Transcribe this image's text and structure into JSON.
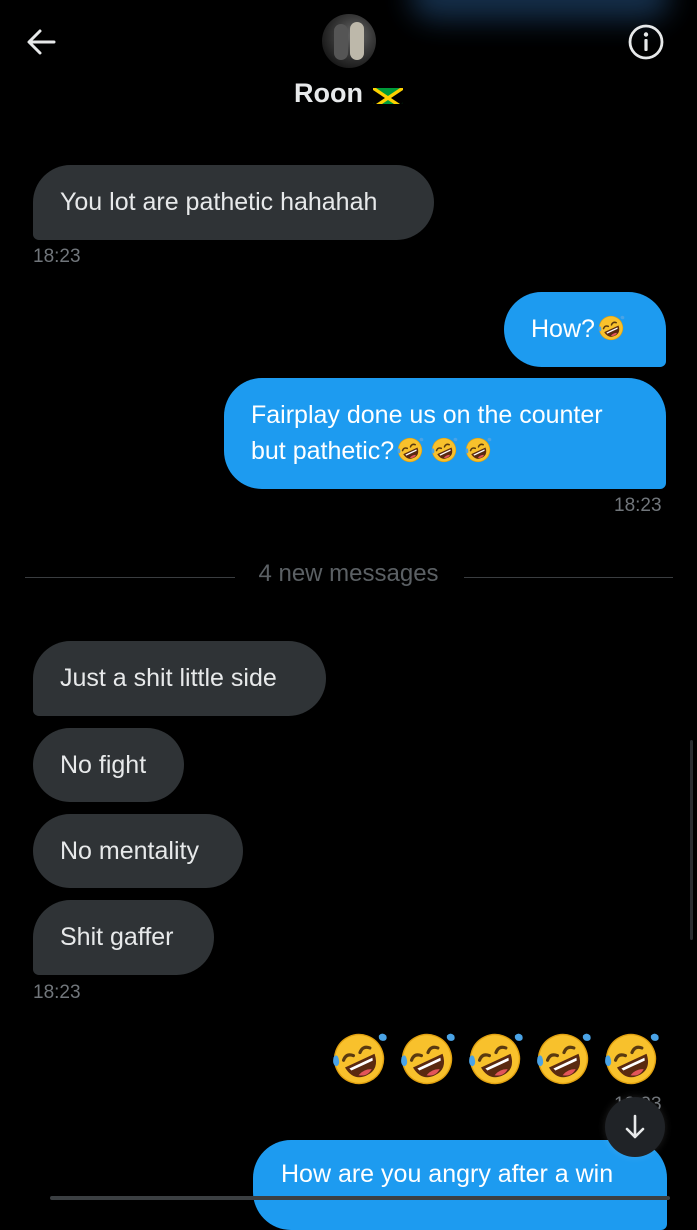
{
  "header": {
    "contact_name": "Roon",
    "back_icon": "arrow-left-icon",
    "info_icon": "info-circle-icon",
    "flag": "jamaica-flag"
  },
  "messages": [
    {
      "direction": "in",
      "text": "You lot are pathetic hahahah"
    },
    {
      "direction": "out",
      "text": "How?",
      "emoji": [
        "rofl"
      ]
    },
    {
      "direction": "out",
      "line1": "Fairplay done us on the counter",
      "line2": "but pathetic?",
      "emoji": [
        "rofl",
        "rofl",
        "rofl"
      ]
    },
    {
      "direction": "in",
      "text": "Just a shit little side"
    },
    {
      "direction": "in",
      "text": "No fight"
    },
    {
      "direction": "in",
      "text": "No mentality"
    },
    {
      "direction": "in",
      "text": "Shit gaffer"
    },
    {
      "direction": "out",
      "emoji": [
        "rofl",
        "rofl",
        "rofl",
        "rofl",
        "rofl"
      ]
    },
    {
      "direction": "out",
      "text": "How are you angry after a win"
    }
  ],
  "timestamps": {
    "t1": "18:23",
    "t2": "18:23",
    "t3": "18:23",
    "t4_partial": "18:23"
  },
  "divider": {
    "label": "4 new messages"
  },
  "colors": {
    "background": "#000000",
    "incoming_bubble": "#2f3336",
    "outgoing_bubble": "#1d9bf0",
    "timestamp": "#71767b"
  },
  "icons": {
    "scroll_down": "arrow-down-icon",
    "emoji": "rolling-on-the-floor-laughing-icon"
  }
}
